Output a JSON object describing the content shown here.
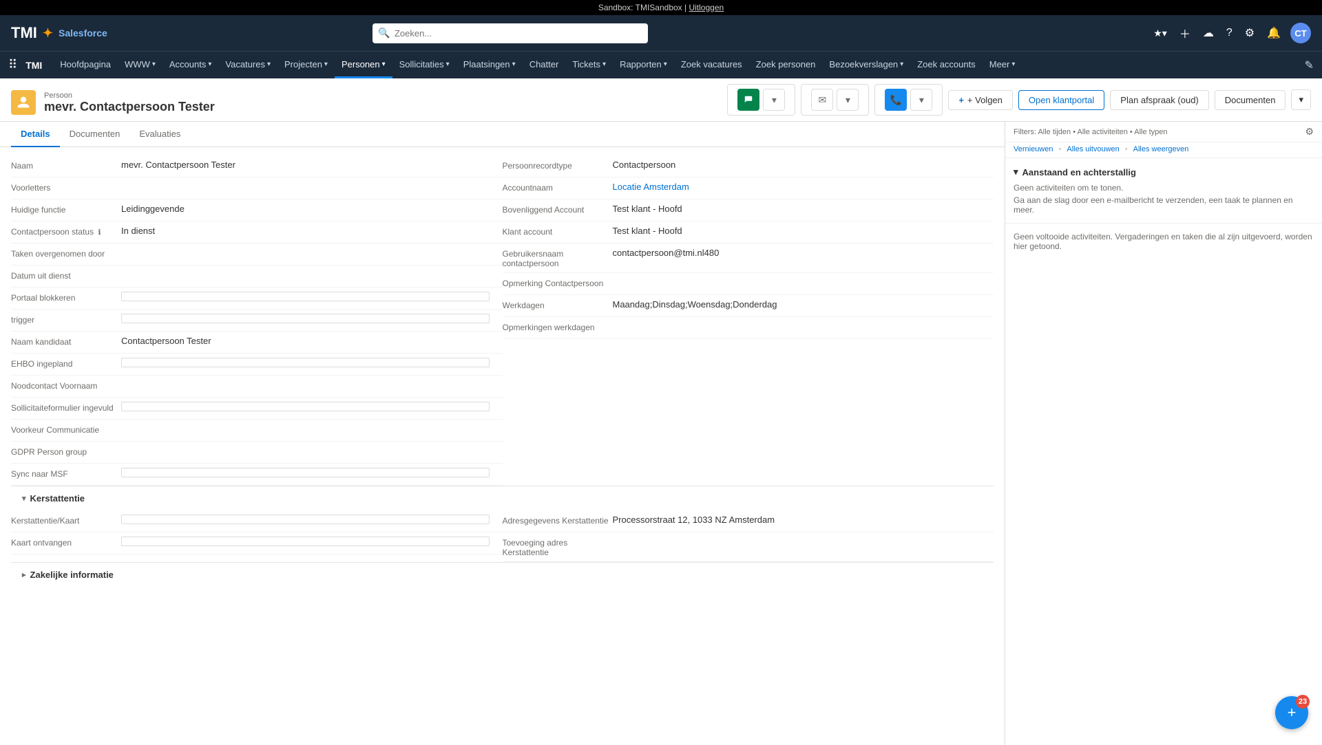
{
  "sandbox_bar": {
    "text": "Sandbox: TMISandbox |",
    "logout_link": "Uitloggen"
  },
  "header": {
    "logo": "TMI",
    "salesforce_text": "Salesforce",
    "search_placeholder": "Zoeken...",
    "icons": [
      "star",
      "plus",
      "cloud",
      "question",
      "gear",
      "bell",
      "avatar"
    ],
    "avatar_initials": "CT"
  },
  "navbar": {
    "brand": "TMI",
    "home": "Hoofdpagina",
    "items": [
      {
        "label": "WWW",
        "has_chevron": true
      },
      {
        "label": "Accounts",
        "has_chevron": true
      },
      {
        "label": "Vacatures",
        "has_chevron": true
      },
      {
        "label": "Projecten",
        "has_chevron": true
      },
      {
        "label": "Personen",
        "has_chevron": true,
        "active": true
      },
      {
        "label": "Sollicitaties",
        "has_chevron": true
      },
      {
        "label": "Plaatsingen",
        "has_chevron": true
      },
      {
        "label": "Chatter",
        "has_chevron": false
      },
      {
        "label": "Tickets",
        "has_chevron": true
      },
      {
        "label": "Rapporten",
        "has_chevron": true
      },
      {
        "label": "Zoek vacatures",
        "has_chevron": false
      },
      {
        "label": "Zoek personen",
        "has_chevron": false
      },
      {
        "label": "Bezoekverslagen",
        "has_chevron": true
      },
      {
        "label": "Zoek accounts",
        "has_chevron": false
      },
      {
        "label": "Meer",
        "has_chevron": true
      }
    ]
  },
  "record": {
    "type_label": "Persoon",
    "title": "mevr. Contactpersoon Tester",
    "actions": {
      "follow_label": "+ Volgen",
      "open_portal_label": "Open klantportal",
      "plan_afspraak_label": "Plan afspraak (oud)",
      "documenten_label": "Documenten"
    }
  },
  "tabs": [
    {
      "label": "Details",
      "active": true
    },
    {
      "label": "Documenten"
    },
    {
      "label": "Evaluaties"
    }
  ],
  "left_fields": [
    {
      "label": "Naam",
      "value": "mevr. Contactpersoon Tester",
      "type": "text",
      "editable": true
    },
    {
      "label": "Voorletters",
      "value": "",
      "type": "text",
      "editable": true
    },
    {
      "label": "Huidige functie",
      "value": "Leidinggevende",
      "type": "text",
      "editable": true
    },
    {
      "label": "Contactpersoon status",
      "value": "In dienst",
      "type": "text",
      "editable": true,
      "info": true
    },
    {
      "label": "Taken overgenomen door",
      "value": "",
      "type": "text",
      "editable": true
    },
    {
      "label": "Datum uit dienst",
      "value": "",
      "type": "text",
      "editable": true
    },
    {
      "label": "Portaal blokkeren",
      "value": "",
      "type": "checkbox",
      "editable": true
    },
    {
      "label": "trigger",
      "value": "",
      "type": "checkbox",
      "editable": true
    },
    {
      "label": "Naam kandidaat",
      "value": "Contactpersoon Tester",
      "type": "text",
      "editable": false
    },
    {
      "label": "EHBO ingepland",
      "value": "",
      "type": "checkbox",
      "editable": true
    },
    {
      "label": "Noodcontact Voornaam",
      "value": "",
      "type": "text",
      "editable": true
    },
    {
      "label": "Sollicitaiteformulier ingevuld",
      "value": "",
      "type": "checkbox",
      "editable": true
    },
    {
      "label": "Voorkeur Communicatie",
      "value": "",
      "type": "text",
      "editable": true
    },
    {
      "label": "GDPR Person group",
      "value": "",
      "type": "text",
      "editable": false
    },
    {
      "label": "Sync naar MSF",
      "value": "",
      "type": "checkbox",
      "editable": true
    }
  ],
  "right_fields": [
    {
      "label": "Persoonrecordtype",
      "value": "Contactpersoon",
      "type": "text",
      "editable": true
    },
    {
      "label": "Accountnaam",
      "value": "Locatie Amsterdam",
      "type": "link",
      "editable": true
    },
    {
      "label": "Bovenliggend Account",
      "value": "Test klant - Hoofd",
      "type": "text",
      "editable": false
    },
    {
      "label": "Klant account",
      "value": "Test klant - Hoofd",
      "type": "text",
      "editable": false
    },
    {
      "label": "Gebruikersnaam contactpersoon",
      "value": "contactpersoon@tmi.nl480",
      "type": "text",
      "editable": true
    },
    {
      "label": "Opmerking Contactpersoon",
      "value": "",
      "type": "text",
      "editable": true
    },
    {
      "label": "Werkdagen",
      "value": "Maandag;Dinsdag;Woensdag;Donderdag",
      "type": "text",
      "editable": true
    },
    {
      "label": "Opmerkingen werkdagen",
      "value": "",
      "type": "text",
      "editable": true
    }
  ],
  "sections": [
    {
      "title": "Kerstattentie",
      "collapsed": false,
      "left_fields": [
        {
          "label": "Kerstattentie/Kaart",
          "value": "",
          "type": "checkbox",
          "editable": true
        },
        {
          "label": "Kaart ontvangen",
          "value": "",
          "type": "checkbox",
          "editable": true
        }
      ],
      "right_fields": [
        {
          "label": "Adresgegevens Kerstattentie",
          "value": "Processorstraat 12, 1033 NZ Amsterdam",
          "type": "text",
          "editable": true
        },
        {
          "label": "Toevoeging adres Kerstattentie",
          "value": "",
          "type": "text",
          "editable": true
        }
      ]
    },
    {
      "title": "Zakelijke informatie",
      "collapsed": true
    }
  ],
  "activity_panel": {
    "filters_text": "Filters: Alle tijden • Alle activiteiten • Alle typen",
    "refresh_label": "Vernieuwen",
    "expand_label": "Alles uitvouwen",
    "view_all_label": "Alles weergeven",
    "upcoming_section": {
      "title": "Aanstaand en achterstallig",
      "no_activity_text": "Geen activiteiten om te tonen.",
      "no_activity_sub": "Ga aan de slag door een e-mailbericht te verzenden, een taak te plannen en meer."
    },
    "past_text": "Geen voltooide activiteiten. Vergaderingen en taken die al zijn uitgevoerd, worden hier getoond."
  },
  "chat": {
    "badge": "23"
  }
}
